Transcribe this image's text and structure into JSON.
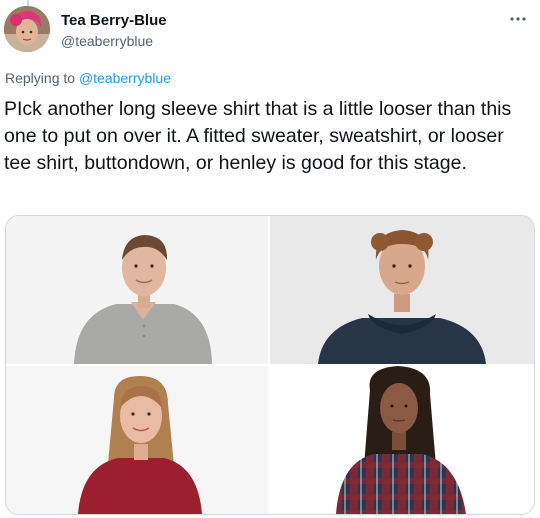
{
  "tweet": {
    "author": {
      "display_name": "Tea Berry-Blue",
      "handle": "@teaberryblue"
    },
    "reply_prefix": "Replying to",
    "reply_to": "@teaberryblue",
    "text": "PIck another long sleeve shirt that is a little looser than this one to put on over it. A fitted sweater, sweatshirt, or looser tee shirt, buttondown, or henley is good for this stage.",
    "more_icon": "more-horizontal-icon",
    "media": [
      {
        "name": "photo-man-henley",
        "depicts": "man in gray henley"
      },
      {
        "name": "photo-man-hoodie",
        "depicts": "man in navy hooded sweater"
      },
      {
        "name": "photo-woman-red-tee",
        "depicts": "woman in red long sleeve tee"
      },
      {
        "name": "photo-woman-flannel",
        "depicts": "woman in plaid flannel shirt"
      }
    ]
  },
  "colors": {
    "text": "#0f1419",
    "muted": "#536471",
    "link": "#1d9bf0",
    "border": "#cfd9de"
  }
}
